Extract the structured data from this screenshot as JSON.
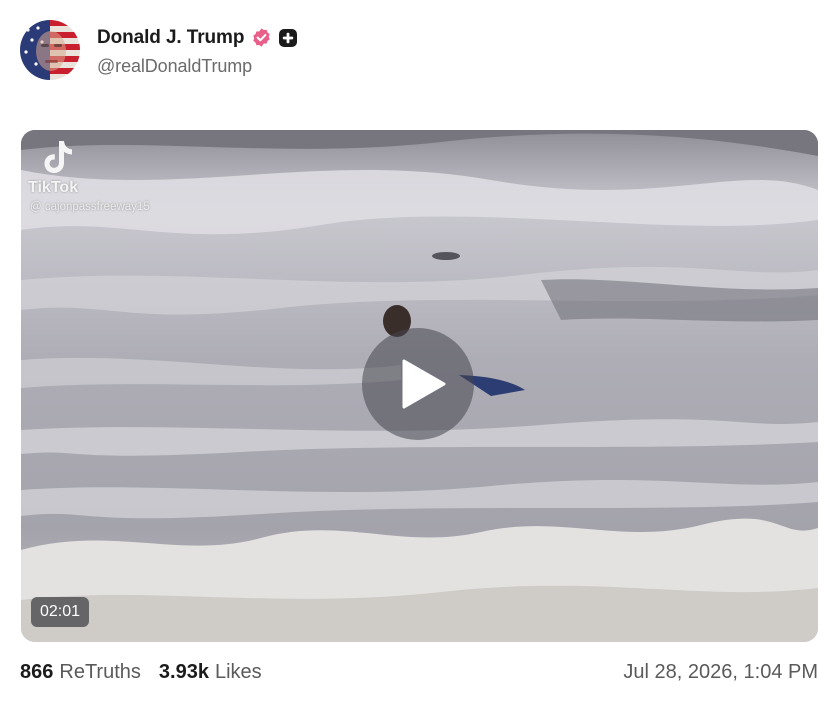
{
  "author": {
    "display_name": "Donald J. Trump",
    "handle": "@realDonaldTrump",
    "verified": true
  },
  "video": {
    "watermark_brand": "TikTok",
    "watermark_user": "@ cajonpassfreeway15",
    "duration": "02:01"
  },
  "stats": {
    "retruths_count": "866",
    "retruths_label": "ReTruths",
    "likes_count": "3.93k",
    "likes_label": "Likes"
  },
  "timestamp": "Jul 28, 2026, 1:04 PM",
  "icons": {
    "verified": "verified-badge-icon",
    "plus": "plus-badge-icon",
    "play": "play-icon"
  },
  "colors": {
    "verified_badge": "#e8608a",
    "text_primary": "#1b1b1b",
    "text_secondary": "#5a5a5a"
  }
}
